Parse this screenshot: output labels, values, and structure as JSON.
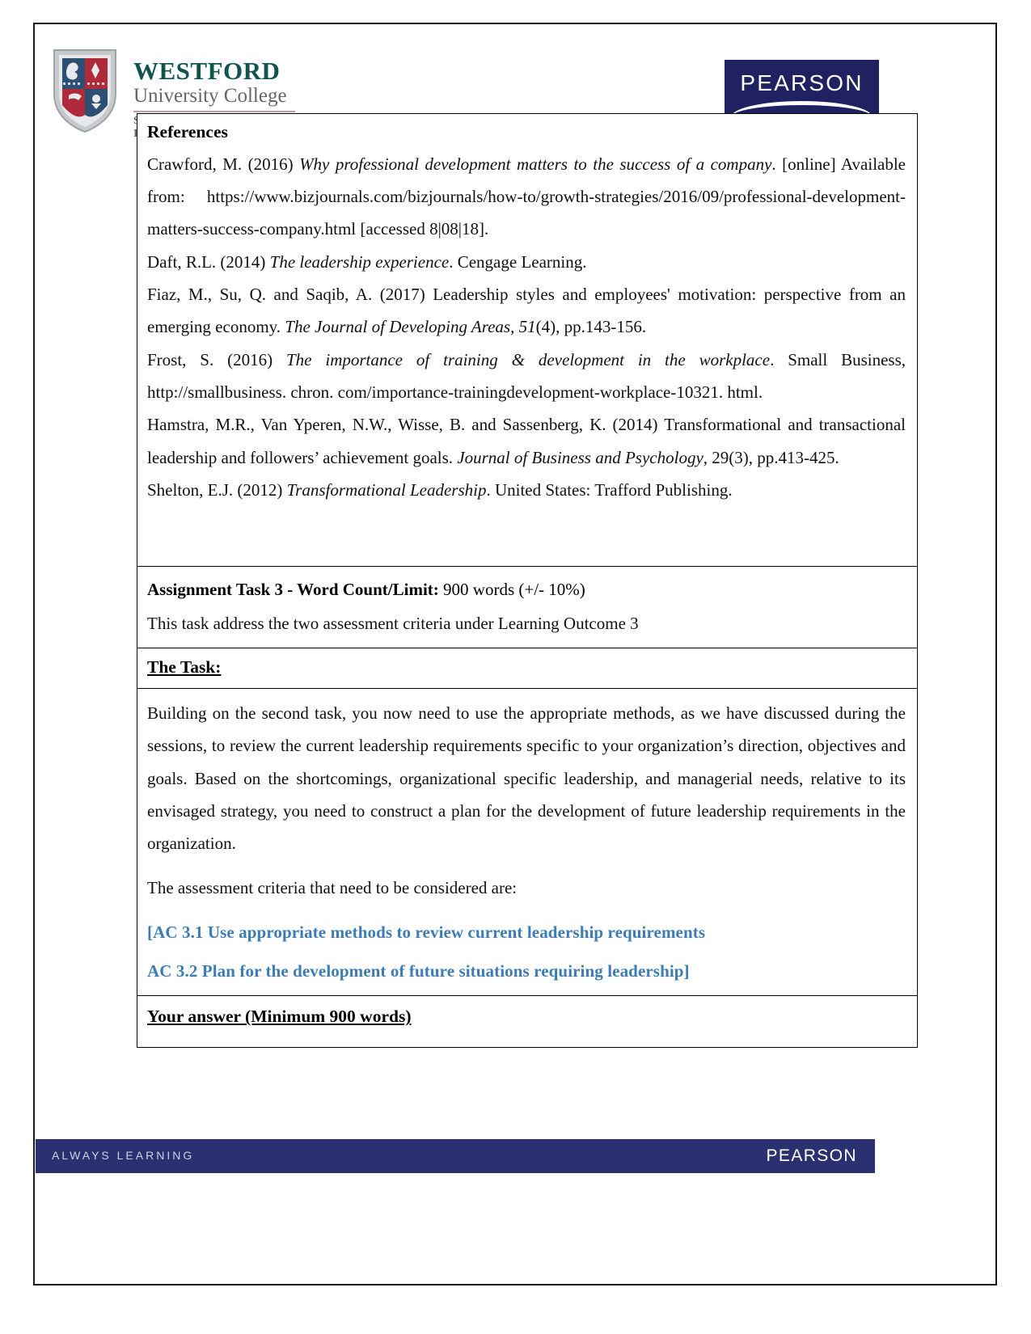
{
  "header": {
    "crest_alt": "westford-university-college-crest",
    "university_name": "WESTFORD",
    "university_sub": "University College",
    "school_line": "School of Business & Information Technology",
    "pearson_logo_text": "PEARSON"
  },
  "references": {
    "title": "References",
    "items": [
      {
        "pre": "Crawford, M. (2016) ",
        "italic": "Why professional development matters to the success of a company",
        "post": ". [online] Available from: https://www.bizjournals.com/bizjournals/how-to/growth-strategies/2016/09/professional-development-matters-success-company.html [accessed 8|08|18]."
      },
      {
        "pre": "Daft, R.L. (2014) ",
        "italic": "The leadership experience",
        "post": ". Cengage Learning."
      },
      {
        "pre": "Fiaz, M., Su, Q. and Saqib, A. (2017) Leadership styles and employees' motivation: perspective from an emerging economy. ",
        "italic": "The Journal of Developing Areas, 51",
        "post": "(4), pp.143-156."
      },
      {
        "pre": "Frost, S. (2016) ",
        "italic": "The importance of training & development in the workplace",
        "post": ". Small Business, http://smallbusiness. chron. com/importance-trainingdevelopment-workplace-10321. html."
      },
      {
        "pre": "Hamstra, M.R., Van Yperen, N.W., Wisse, B. and Sassenberg, K. (2014) Transformational and transactional leadership and followers’ achievement goals. ",
        "italic": "Journal of Business and Psychology",
        "post": ", 29(3), pp.413-425."
      },
      {
        "pre": "Shelton, E.J. (2012) ",
        "italic": "Transformational Leadership",
        "post": ". United States: Trafford Publishing."
      }
    ]
  },
  "assignment": {
    "word_count_label": "Assignment Task 3 - Word Count/Limit:",
    "word_count_value": " 900 words (+/- 10%)",
    "criteria_note": "This task address the two assessment criteria under Learning Outcome 3",
    "task_heading": "The Task:",
    "task_paragraph": "Building on the second task, you now need to use the appropriate methods, as we have discussed during the sessions, to review the current leadership requirements specific to your organization’s direction, objectives and goals. Based on the shortcomings, organizational specific leadership, and managerial needs, relative to its envisaged strategy, you need to construct a plan for the development of future leadership requirements in the organization.",
    "criteria_intro": "The assessment criteria that need to be considered are:",
    "ac_3_1": "[AC 3.1 Use appropriate methods to review current leadership requirements",
    "ac_3_2": "AC 3.2 Plan for the development of future situations requiring leadership]",
    "answer_heading": "Your answer (Minimum 900 words)"
  },
  "footer": {
    "tagline": "ALWAYS LEARNING",
    "brand": "PEARSON"
  },
  "colors": {
    "accent_blue": "#3c7cb5",
    "pearson_navy": "#1f2161",
    "footer_navy": "#2a3070",
    "westford_teal": "#13534f"
  }
}
